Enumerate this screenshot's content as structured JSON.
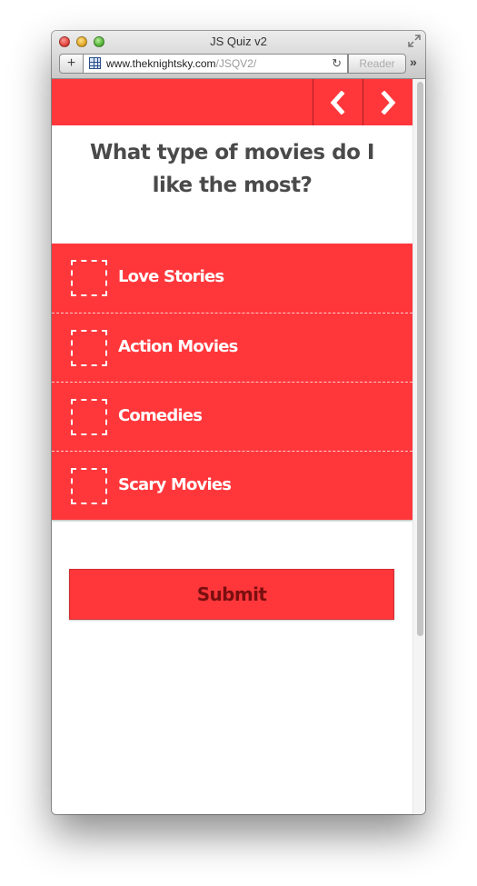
{
  "window": {
    "title": "JS Quiz v2"
  },
  "browser": {
    "url_domain": "www.theknightsky.com",
    "url_path": "/JSQV2/",
    "reader_label": "Reader",
    "add_label": "+",
    "reload_glyph": "↻",
    "overflow_glyph": "»"
  },
  "quiz": {
    "question": "What type of movies do I like the most?",
    "answers": [
      {
        "label": "Love Stories",
        "checked": false
      },
      {
        "label": "Action Movies",
        "checked": false
      },
      {
        "label": "Comedies",
        "checked": false
      },
      {
        "label": "Scary Movies",
        "checked": false
      }
    ],
    "submit_label": "Submit"
  },
  "icons": {
    "prev": "chevron-left-icon",
    "next": "chevron-right-icon",
    "checkbox": "checkbox-empty-icon"
  },
  "colors": {
    "accent": "#ff373b",
    "submit_text": "#7a0f10",
    "question_text": "#4a4a4a"
  }
}
